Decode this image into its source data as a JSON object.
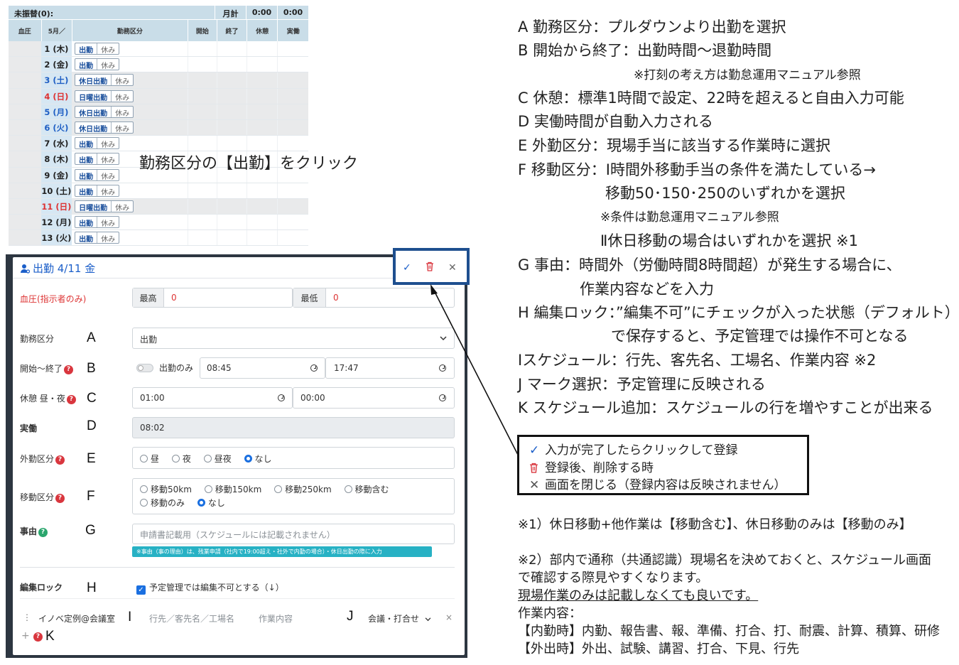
{
  "calendar": {
    "summary_label": "未振替(0):",
    "month_total_label": "月計",
    "total_rest": "0:00",
    "total_actual": "0:00",
    "headers": {
      "bp": "血圧",
      "month": "5月／",
      "kubun": "勤務区分",
      "start": "開始",
      "end": "終了",
      "rest": "休憩",
      "actual": "実働"
    },
    "rows": [
      {
        "day": "1 (木)",
        "on": "出勤",
        "off": "休み",
        "color": "normal",
        "gray": false
      },
      {
        "day": "2 (金)",
        "on": "出勤",
        "off": "休み",
        "color": "normal",
        "gray": false
      },
      {
        "day": "3 (土)",
        "on": "休日出勤",
        "off": "休み",
        "color": "blue",
        "gray": true
      },
      {
        "day": "4 (日)",
        "on": "日曜出勤",
        "off": "休み",
        "color": "red",
        "gray": true
      },
      {
        "day": "5 (月)",
        "on": "休日出勤",
        "off": "休み",
        "color": "blue",
        "gray": true
      },
      {
        "day": "6 (火)",
        "on": "休日出勤",
        "off": "休み",
        "color": "blue",
        "gray": true
      },
      {
        "day": "7 (水)",
        "on": "出勤",
        "off": "休み",
        "color": "normal",
        "gray": false
      },
      {
        "day": "8 (木)",
        "on": "出勤",
        "off": "休み",
        "color": "normal",
        "gray": false
      },
      {
        "day": "9 (金)",
        "on": "出勤",
        "off": "休み",
        "color": "normal",
        "gray": false
      },
      {
        "day": "10 (土)",
        "on": "出勤",
        "off": "休み",
        "color": "normal",
        "gray": false
      },
      {
        "day": "11 (日)",
        "on": "日曜出勤",
        "off": "休み",
        "color": "red",
        "gray": true
      },
      {
        "day": "12 (月)",
        "on": "出勤",
        "off": "休み",
        "color": "normal",
        "gray": false
      },
      {
        "day": "13 (火)",
        "on": "出勤",
        "off": "休み",
        "color": "normal",
        "gray": false
      }
    ],
    "instruction": "勤務区分の【出勤】をクリック"
  },
  "modal": {
    "title": "出勤 4/11 金",
    "actions": {
      "confirm_icon": "check-icon",
      "delete_icon": "trash-icon",
      "close_icon": "close-icon"
    },
    "blood_pressure": {
      "label": "血圧(指示者のみ)",
      "max_label": "最高",
      "max_value": "0",
      "min_label": "最低",
      "min_value": "0"
    },
    "kubun": {
      "label": "勤務区分",
      "letter": "A",
      "value": "出勤"
    },
    "time": {
      "label": "開始～終了",
      "letter": "B",
      "toggle_label": "出勤のみ",
      "start": "08:45",
      "end": "17:47"
    },
    "rest": {
      "label": "休憩 昼・夜",
      "letter": "C",
      "day": "01:00",
      "night": "00:00"
    },
    "actual": {
      "label": "実働",
      "letter": "D",
      "value": "08:02"
    },
    "gaikin": {
      "label": "外勤区分",
      "letter": "E",
      "options": [
        "昼",
        "夜",
        "昼夜",
        "なし"
      ],
      "selected": "なし"
    },
    "idou": {
      "label": "移動区分",
      "letter": "F",
      "options_line1": [
        "移動50km",
        "移動150km",
        "移動250km",
        "移動含む"
      ],
      "options_line2": [
        "移動のみ",
        "なし"
      ],
      "selected": "なし"
    },
    "reason": {
      "label": "事由",
      "letter": "G",
      "placeholder": "申請書記載用（スケジュールには記載されません）",
      "hint": "※事由（事の理由）は、残業申請（社内で19:00超え・社外で内勤の場合）・休日出勤の際に入力"
    },
    "lock": {
      "label": "編集ロック",
      "letter": "H",
      "checkbox_label": "予定管理では編集不可とする（↓）",
      "checked": true
    },
    "schedule": {
      "place": "イノベ定例@会議室",
      "letter_i": "I",
      "dest_placeholder": "行先／客先名／工場名",
      "work_placeholder": "作業内容",
      "letter_j": "J",
      "mark": "会議・打合せ",
      "add_letter": "K"
    }
  },
  "notes": {
    "lines": [
      "A 勤務区分：プルダウンより出勤を選択",
      "B 開始から終了：出勤時間～退勤時間",
      "※打刻の考え方は勤怠運用マニュアル参照",
      "C 休憩：標準1時間で設定、22時を超えると自由入力可能",
      "D 実働時間が自動入力される",
      "E 外勤区分：現場手当に該当する作業時に選択",
      "F 移動区分：Ⅰ時間外移動手当の条件を満たしている→",
      "移動50･150･250のいずれかを選択",
      "※条件は勤怠運用マニュアル参照",
      "Ⅱ休日移動の場合はいずれかを選択 ※1",
      "G 事由：時間外（労働時間8時間超）が発生する場合に、",
      "作業内容などを入力",
      "H 編集ロック：”編集不可”にチェックが入った状態（デフォルト）",
      "で保存すると、予定管理では操作不可となる",
      "Ⅰスケジュール：行先、客先名、工場名、作業内容 ※2",
      "J マーク選択：予定管理に反映される",
      "K スケジュール追加：スケジュールの行を増やすことが出来る"
    ],
    "legend": [
      {
        "icon": "check-icon",
        "glyph": "✓",
        "text": "入力が完了したらクリックして登録"
      },
      {
        "icon": "trash-icon",
        "glyph": "🗑",
        "text": "登録後、削除する時"
      },
      {
        "icon": "close-icon",
        "glyph": "✕",
        "text": "画面を閉じる（登録内容は反映されません）"
      }
    ],
    "footnote1": "※1）休日移動+他作業は【移動含む】、休日移動のみは【移動のみ】",
    "footnote2_line1": "※2）部内で通称（共通認識）現場名を決めておくと、スケジュール画面",
    "footnote2_line2": "で確認する際見やすくなります。",
    "footnote2_line3": "現場作業のみは記載しなくても良いです。",
    "work_title": "作業内容：",
    "work_inner": "【内勤時】内勤、報告書、報、準備、打合、打、耐震、計算、積算、研修",
    "work_outer": "【外出時】外出、試験、講習、打合、下見、行先"
  },
  "colors": {
    "accent": "#1c5fc9",
    "danger": "#d9363e",
    "hint": "#27b1c4",
    "frame": "#1e4f8f"
  }
}
